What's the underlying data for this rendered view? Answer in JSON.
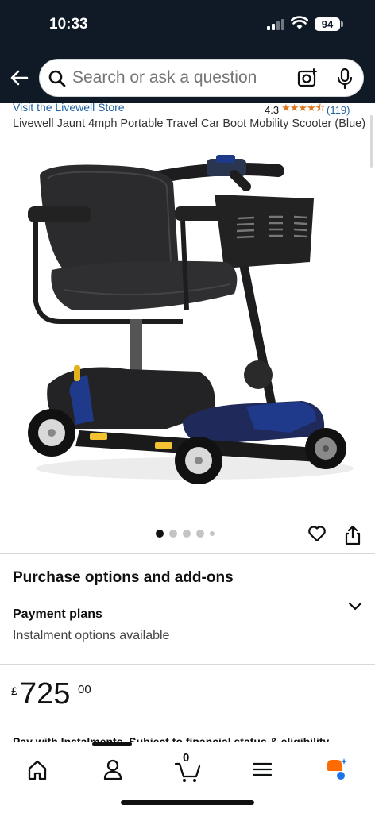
{
  "status_bar": {
    "time": "10:33",
    "battery": "94"
  },
  "search": {
    "placeholder": "Search or ask a question"
  },
  "product": {
    "store_link": "Visit the Livewell Store",
    "rating": "4.3",
    "stars": "★★★★⯪",
    "rating_count": "(119)",
    "title": "Livewell Jaunt 4mph Portable Travel Car Boot Mobility Scooter (Blue)",
    "image_count": 5,
    "active_image": 1
  },
  "purchase": {
    "heading": "Purchase options and add-ons",
    "payment_plans_label": "Payment plans",
    "payment_plans_sub": "Instalment options available"
  },
  "price": {
    "currency": "£",
    "whole": "725",
    "fraction": "00"
  },
  "instalment_note": "Pay with Instalments. Subject to financial status & eligibility",
  "tabbar": {
    "items": [
      "home-icon",
      "account-icon",
      "cart-icon",
      "menu-icon",
      "rufus-icon"
    ],
    "cart_count": "0"
  },
  "colors": {
    "header_bg": "#0f1a26",
    "link": "#2162a1",
    "star": "#de7921",
    "scooter_blue": "#1f3a8a",
    "rufus_orange": "#ff6b00",
    "rufus_blue": "#1a73e8"
  }
}
